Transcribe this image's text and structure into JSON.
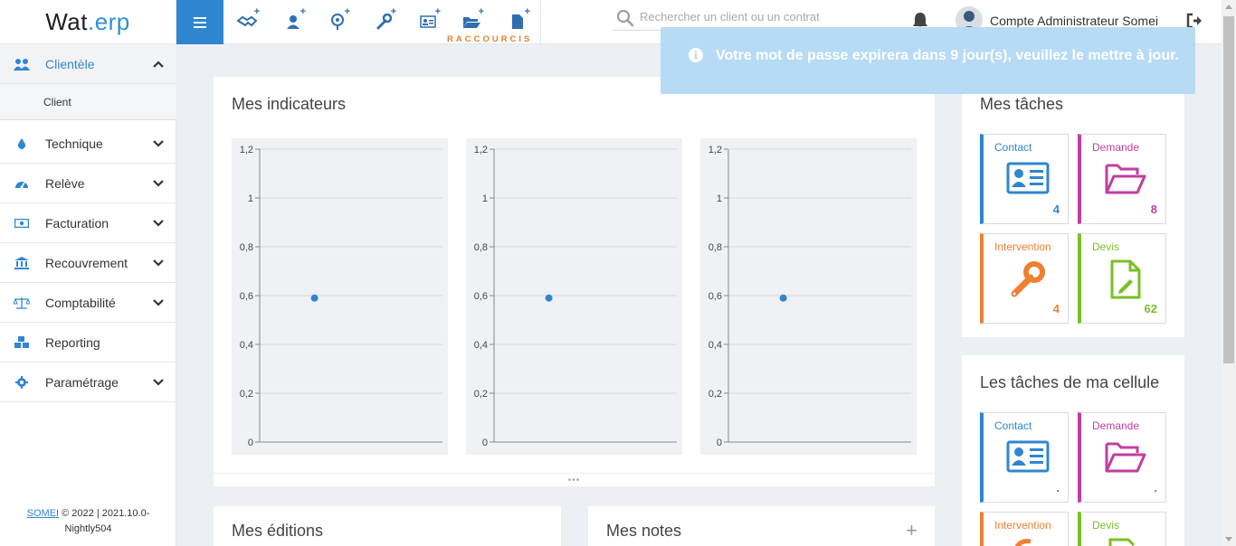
{
  "app": {
    "logo_part1": "Wat",
    "logo_part2": ".erp"
  },
  "header": {
    "shortcuts_label": "RACCOURCIS",
    "search_placeholder": "Rechercher un client ou un contrat",
    "user_name": "Compte Administrateur Somei"
  },
  "notification": {
    "text": "Votre mot de passe expirera dans 9 jour(s), veuillez le mettre à jour."
  },
  "sidebar": {
    "items": [
      {
        "label": "Clientèle",
        "icon": "users-icon"
      },
      {
        "label": "Technique",
        "icon": "drop-icon"
      },
      {
        "label": "Relève",
        "icon": "gauge-icon"
      },
      {
        "label": "Facturation",
        "icon": "money-icon"
      },
      {
        "label": "Recouvrement",
        "icon": "bank-icon"
      },
      {
        "label": "Comptabilité",
        "icon": "balance-icon"
      },
      {
        "label": "Reporting",
        "icon": "cubes-icon"
      },
      {
        "label": "Paramétrage",
        "icon": "gear-icon"
      }
    ],
    "sub_items": [
      {
        "label": "Client"
      }
    ],
    "footer_link": "SOMEI",
    "footer_line1": " © 2022 | 2021.10.0-",
    "footer_line2": "Nightly504"
  },
  "indicators": {
    "title": "Mes indicateurs",
    "chart_data": [
      {
        "type": "scatter",
        "y_ticks": [
          "1,2",
          "1",
          "0,8",
          "0,6",
          "0,4",
          "0,2",
          "0"
        ],
        "ylim": [
          0,
          1.2
        ],
        "points": [
          {
            "x": 0.5,
            "y": 0.59
          }
        ]
      },
      {
        "type": "scatter",
        "y_ticks": [
          "1,2",
          "1",
          "0,8",
          "0,6",
          "0,4",
          "0,2",
          "0"
        ],
        "ylim": [
          0,
          1.2
        ],
        "points": [
          {
            "x": 0.5,
            "y": 0.59
          }
        ]
      },
      {
        "type": "scatter",
        "y_ticks": [
          "1,2",
          "1",
          "0,8",
          "0,6",
          "0,4",
          "0,2",
          "0"
        ],
        "ylim": [
          0,
          1.2
        ],
        "points": [
          {
            "x": 0.5,
            "y": 0.59
          }
        ]
      }
    ]
  },
  "editions": {
    "title": "Mes éditions"
  },
  "notes": {
    "title": "Mes notes",
    "add_label": "+"
  },
  "my_tasks": {
    "title": "Mes tâches",
    "tiles": [
      {
        "label": "Contact",
        "count": "4",
        "color": "#2f86d0"
      },
      {
        "label": "Demande",
        "count": "8",
        "color": "#c23ea1"
      },
      {
        "label": "Intervention",
        "count": "4",
        "color": "#f07f32"
      },
      {
        "label": "Devis",
        "count": "62",
        "color": "#7cbf25"
      }
    ]
  },
  "cell_tasks": {
    "title": "Les tâches de ma cellule",
    "tiles": [
      {
        "label": "Contact",
        "count": ".",
        "color": "#2f86d0"
      },
      {
        "label": "Demande",
        "count": ".",
        "color": "#c23ea1"
      },
      {
        "label": "Intervention",
        "count": "",
        "color": "#f07f32"
      },
      {
        "label": "Devis",
        "count": "",
        "color": "#7cbf25"
      }
    ]
  }
}
